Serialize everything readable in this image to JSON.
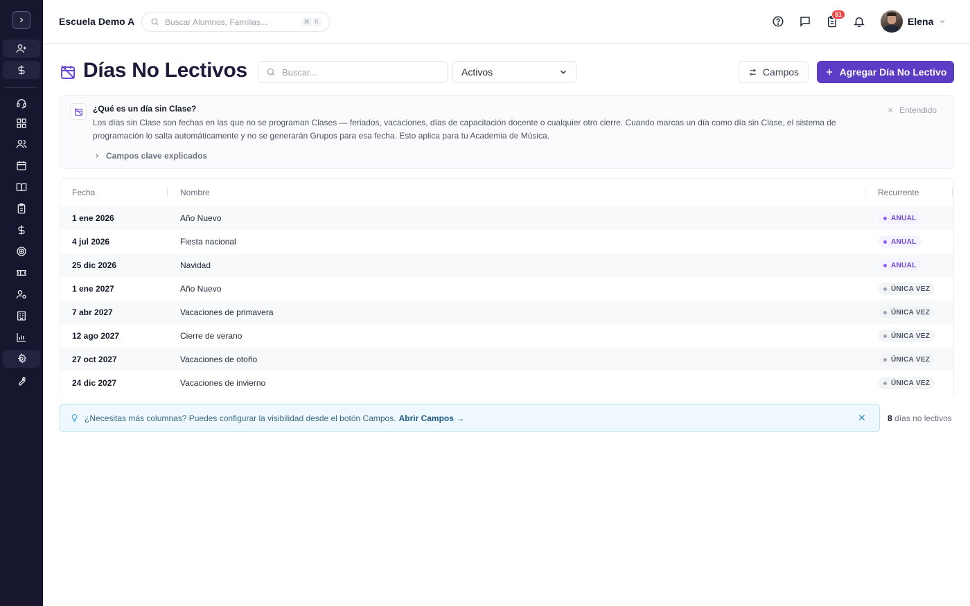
{
  "topbar": {
    "school_name": "Escuela Demo A",
    "search_placeholder": "Buscar Alumnos, Familias...",
    "shortcut_keys": [
      "⌘",
      "K"
    ],
    "notification_count": "51",
    "user_name": "Elena"
  },
  "sidebar": {
    "items": [
      "add-user",
      "dollar",
      "headset",
      "grid",
      "users",
      "calendar",
      "book",
      "clipboard",
      "dollar",
      "target",
      "ticket",
      "user-settings",
      "building",
      "chart",
      "settings",
      "wrench"
    ]
  },
  "page": {
    "title": "Días No Lectivos",
    "search_placeholder": "Buscar...",
    "filter_value": "Activos",
    "fields_button": "Campos",
    "add_button": "Agregar Día No Lectivo"
  },
  "info": {
    "title": "¿Qué es un día sin Clase?",
    "text": "Los días sin Clase son fechas en las que no se programan Clases — feriados, vacaciones, días de capacitación docente o cualquier otro cierre. Cuando marcas un día como día sin Clase, el sistema de programación lo salta automáticamente y no se generarán Grupos para esa fecha. Esto aplica para tu Academia de Música.",
    "dismiss": "Entendido",
    "more": "Campos clave explicados"
  },
  "table": {
    "headers": [
      "Fecha",
      "Nombre",
      "Recurrente"
    ],
    "rows": [
      {
        "fecha": "1 ene 2026",
        "nombre": "Año Nuevo",
        "recurrente": "ANUAL",
        "tipo": "anual"
      },
      {
        "fecha": "4 jul 2026",
        "nombre": "Fiesta nacional",
        "recurrente": "ANUAL",
        "tipo": "anual"
      },
      {
        "fecha": "25 dic 2026",
        "nombre": "Navidad",
        "recurrente": "ANUAL",
        "tipo": "anual"
      },
      {
        "fecha": "1 ene 2027",
        "nombre": "Año Nuevo",
        "recurrente": "ÚNICA VEZ",
        "tipo": "unica"
      },
      {
        "fecha": "7 abr 2027",
        "nombre": "Vacaciones de primavera",
        "recurrente": "ÚNICA VEZ",
        "tipo": "unica"
      },
      {
        "fecha": "12 ago 2027",
        "nombre": "Cierre de verano",
        "recurrente": "ÚNICA VEZ",
        "tipo": "unica"
      },
      {
        "fecha": "27 oct 2027",
        "nombre": "Vacaciones de otoño",
        "recurrente": "ÚNICA VEZ",
        "tipo": "unica"
      },
      {
        "fecha": "24 dic 2027",
        "nombre": "Vacaciones de invierno",
        "recurrente": "ÚNICA VEZ",
        "tipo": "unica"
      }
    ]
  },
  "tip": {
    "text": "¿Necesitas más columnas? Puedes configurar la visibilidad desde el botón Campos.",
    "link": "Abrir Campos →"
  },
  "footer": {
    "count": "8",
    "count_label": "días no lectivos"
  },
  "colors": {
    "sidebar_bg": "#16162e",
    "accent": "#5b3cc4",
    "badge": "#ef4444"
  }
}
